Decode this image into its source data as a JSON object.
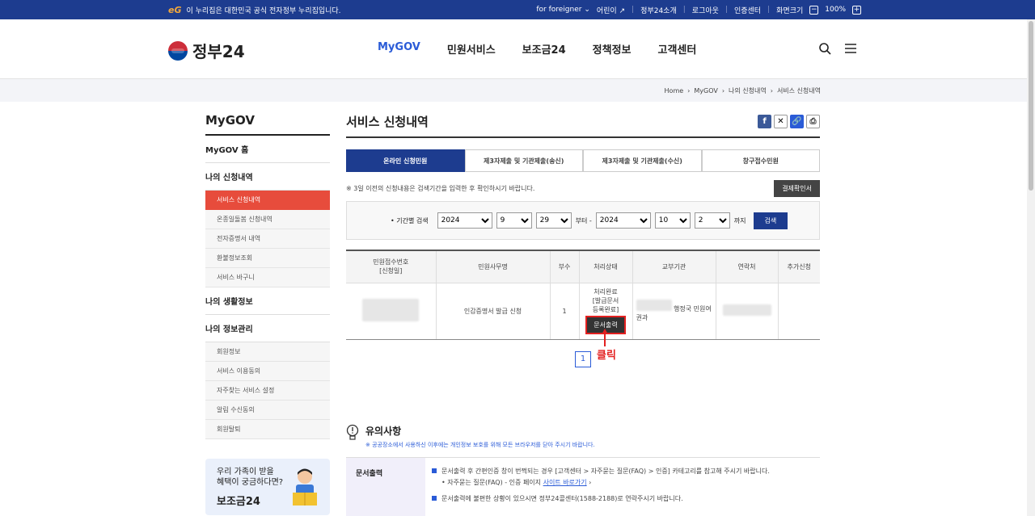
{
  "topbar": {
    "notice": "이 누리집은 대한민국 공식 전자정부 누리집입니다.",
    "for_foreigner": "for foreigner",
    "kids": "어린이",
    "about": "정부24소개",
    "logout": "로그아웃",
    "cert": "인증센터",
    "zoom_label": "화면크기",
    "zoom": "100%"
  },
  "header": {
    "logo": "정부24",
    "nav": [
      "MyGOV",
      "민원서비스",
      "보조금24",
      "정책정보",
      "고객센터"
    ]
  },
  "breadcrumb": [
    "Home",
    "MyGOV",
    "나의 신청내역",
    "서비스 신청내역"
  ],
  "lnb": {
    "title": "MyGOV",
    "home": "MyGOV 홈",
    "apply": "나의 신청내역",
    "apply_items": [
      "서비스 신청내역",
      "온종일돌봄 신청내역",
      "전자증명서 내역",
      "환불정보조회",
      "서비스 바구니"
    ],
    "life": "나의 생활정보",
    "info": "나의 정보관리",
    "info_items": [
      "회원정보",
      "서비스 이용동의",
      "자주찾는 서비스 설정",
      "알림 수신동의",
      "회원탈퇴"
    ],
    "banner_line1": "우리 가족이 받을",
    "banner_line2": "혜택이 궁금하다면?",
    "banner_brand": "보조금24"
  },
  "content": {
    "title": "서비스 신청내역",
    "tabs": [
      "온라인 신청민원",
      "제3자제출 및 기관제출(송신)",
      "제3자제출 및 기관제출(수신)",
      "창구접수민원"
    ],
    "notice": "※ 3일 이전의 신청내용은 검색기간을 입력한 후 확인하시기 바랍니다.",
    "pay_button": "결제확인서",
    "filter": {
      "label": "• 기간별 검색",
      "from_year": "2024",
      "from_month": "9",
      "from_day": "29",
      "from_suffix": "부터 -",
      "to_year": "2024",
      "to_month": "10",
      "to_day": "2",
      "to_suffix": "까지",
      "search": "검색"
    },
    "table": {
      "headers": [
        "민원접수번호\n[신청일]",
        "민원사무명",
        "부수",
        "처리상태",
        "교부기관",
        "연락처",
        "추가신청"
      ],
      "row": {
        "name": "인감증명서 발급 신청",
        "count": "1",
        "status": "처리완료\n[발급문서\n등록완료]",
        "print": "문서출력",
        "org": "행정국 민원여권과"
      }
    },
    "page": "1",
    "click_note": "클릭",
    "caution_title": "유의사항",
    "caution_sub": "※ 공공장소에서 사용하신 이후에는 개인정보 보호를 위해 모든 브라우저를 닫아 주시기 바랍니다.",
    "box_label": "문서출력",
    "box_line1": "문서출력 후 간편인증 창이 번쩍되는 경우 [고객센터 > 자주묻는 질문(FAQ) > 인증] 카테고리를 참고해 주시기 바랍니다.",
    "box_line2": "• 자주묻는 질문(FAQ) - 인증 페이지",
    "box_link": "사이트 바로가기",
    "box_line3": "문서출력에 불편한 상황이 있으시면 정부24콜센터(1588-2188)로 연락주시기 바랍니다."
  },
  "colors": {
    "primary": "#1d3c8f",
    "accent": "#2a5bd7",
    "active_menu": "#e74c3c",
    "highlight": "#e32020"
  }
}
